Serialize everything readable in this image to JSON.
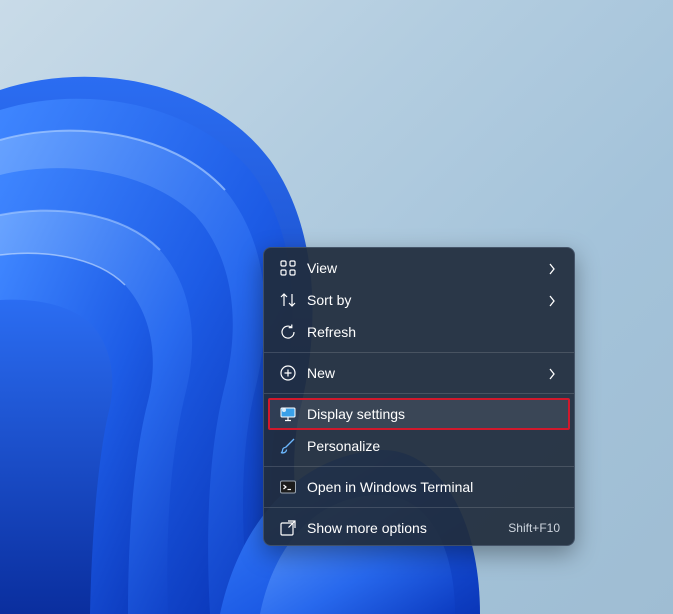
{
  "menu": {
    "items": [
      {
        "label": "View",
        "icon": "grid-icon",
        "submenu": true
      },
      {
        "label": "Sort by",
        "icon": "sort-icon",
        "submenu": true
      },
      {
        "label": "Refresh",
        "icon": "refresh-icon",
        "submenu": false
      },
      {
        "label": "New",
        "icon": "plus-circle-icon",
        "submenu": true
      },
      {
        "label": "Display settings",
        "icon": "display-icon",
        "submenu": false
      },
      {
        "label": "Personalize",
        "icon": "brush-icon",
        "submenu": false
      },
      {
        "label": "Open in Windows Terminal",
        "icon": "terminal-icon",
        "submenu": false
      },
      {
        "label": "Show more options",
        "icon": "more-options-icon",
        "submenu": false,
        "shortcut": "Shift+F10"
      }
    ],
    "highlighted_item": "Display settings",
    "highlight_color": "#d1192c"
  },
  "colors": {
    "menu_background": "#202c3c",
    "menu_text": "#ffffff",
    "wallpaper_blue": "#1a5ee0"
  }
}
